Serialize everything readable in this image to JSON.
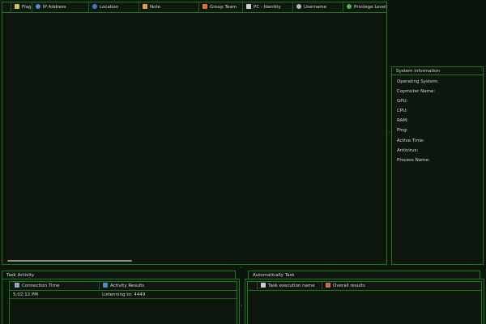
{
  "main_table": {
    "columns": [
      {
        "label": "Flag",
        "icon": "flag-icon",
        "icon_color": "#d4c04a"
      },
      {
        "label": "IP Address",
        "icon": "location-pin-icon",
        "icon_color": "#4a8fd4"
      },
      {
        "label": "Location",
        "icon": "globe-icon",
        "icon_color": "#3a7ac8"
      },
      {
        "label": "Note",
        "icon": "note-icon",
        "icon_color": "#e0a040"
      },
      {
        "label": "Group Team",
        "icon": "group-icon",
        "icon_color": "#e07030"
      },
      {
        "label": "PC - Identity",
        "icon": "pc-icon",
        "icon_color": "#c8d0d8"
      },
      {
        "label": "Username",
        "icon": "user-icon",
        "icon_color": "#b0b8c0"
      },
      {
        "label": "Privilege Level",
        "icon": "shield-icon",
        "icon_color": "#4ab84a"
      }
    ],
    "rows": []
  },
  "system_info": {
    "title": "System information",
    "fields": [
      {
        "label": "Operating System:"
      },
      {
        "label": "Copmuter Name:"
      },
      {
        "label": "GPU:"
      },
      {
        "label": "CPU:"
      },
      {
        "label": "RAM:"
      },
      {
        "label": "Ping:"
      },
      {
        "label": "Active Time:"
      },
      {
        "label": "Antivirus:"
      },
      {
        "label": "Process Name:"
      }
    ]
  },
  "task_activity": {
    "title": "Task Activity",
    "columns": [
      {
        "label": "Connection Time",
        "icon": "connection-icon"
      },
      {
        "label": "Activity  Results",
        "icon": "monitor-icon"
      }
    ],
    "rows": [
      {
        "time": "5:02:12 PM",
        "result": "Listenning to: 4449"
      }
    ]
  },
  "auto_task": {
    "title": "Automatically Task",
    "columns": [
      {
        "label": "Task execution  name",
        "icon": "document-icon"
      },
      {
        "label": "Overall results",
        "icon": "chart-icon"
      }
    ],
    "rows": []
  },
  "colors": {
    "border": "#1f7a1f",
    "background": "#0c150c",
    "text": "#d6dcd6"
  }
}
